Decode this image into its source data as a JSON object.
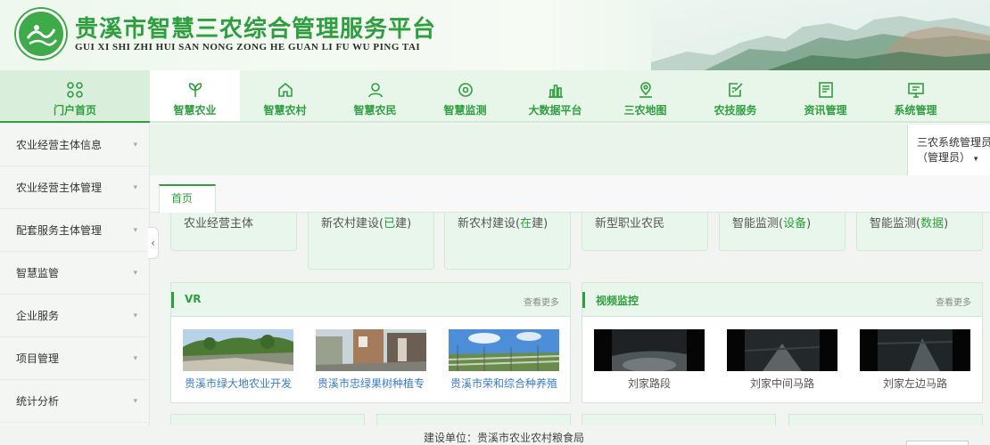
{
  "header": {
    "title": "贵溪市智慧三农综合管理服务平台",
    "subtitle": "GUI XI SHI ZHI HUI SAN NONG ZONG HE GUAN LI FU WU PING TAI",
    "brand_color": "#2f9e3f"
  },
  "nav": {
    "items": [
      {
        "label": "门户首页",
        "icon": "grid-icon"
      },
      {
        "label": "智慧农业",
        "icon": "sprout-icon"
      },
      {
        "label": "智慧农村",
        "icon": "home-icon"
      },
      {
        "label": "智慧农民",
        "icon": "user-icon"
      },
      {
        "label": "智慧监测",
        "icon": "eye-icon"
      },
      {
        "label": "大数据平台",
        "icon": "bar-chart-icon"
      },
      {
        "label": "三农地图",
        "icon": "map-pin-icon"
      },
      {
        "label": "农技服务",
        "icon": "edit-doc-icon"
      },
      {
        "label": "资讯管理",
        "icon": "news-icon"
      },
      {
        "label": "系统管理",
        "icon": "monitor-icon"
      }
    ],
    "active_index": 1
  },
  "sidebar": {
    "items": [
      {
        "label": "农业经营主体信息"
      },
      {
        "label": "农业经营主体管理"
      },
      {
        "label": "配套服务主体管理"
      },
      {
        "label": "智慧监管"
      },
      {
        "label": "企业服务"
      },
      {
        "label": "项目管理"
      },
      {
        "label": "统计分析"
      }
    ],
    "chevron": "▾",
    "collapse_glyph": "‹"
  },
  "user": {
    "line1": "三农系统管理员",
    "line2": "（管理员）",
    "caret": "▾"
  },
  "tabs": {
    "home_label": "首页"
  },
  "stats": [
    {
      "prefix": "农业经营主体",
      "highlight": "",
      "suffix": ""
    },
    {
      "prefix": "新农村建设(",
      "highlight": "已",
      "suffix": "建)"
    },
    {
      "prefix": "新农村建设(",
      "highlight": "在",
      "suffix": "建)"
    },
    {
      "prefix": "新型职业农民",
      "highlight": "",
      "suffix": ""
    },
    {
      "prefix": "智能监测(",
      "highlight": "设备",
      "suffix": ")"
    },
    {
      "prefix": "智能监测(",
      "highlight": "数据",
      "suffix": ")"
    }
  ],
  "vr_panel": {
    "title": "VR",
    "more": "查看更多",
    "items": [
      {
        "caption": "贵溪市绿大地农业开发"
      },
      {
        "caption": "贵溪市忠绿果树种植专"
      },
      {
        "caption": "贵溪市荣和综合种养殖"
      }
    ],
    "caption_color": "#3a7bc8"
  },
  "video_panel": {
    "title": "视频监控",
    "more": "查看更多",
    "items": [
      {
        "caption": "刘家路段"
      },
      {
        "caption": "刘家中间马路"
      },
      {
        "caption": "刘家左边马路"
      }
    ]
  },
  "footer": {
    "text": "建设单位：贵溪市农业农村粮食局"
  }
}
